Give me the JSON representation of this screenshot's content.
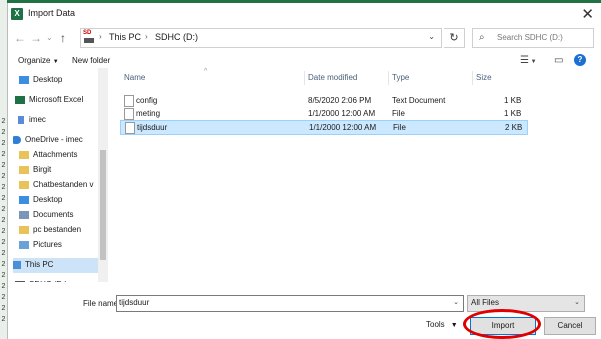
{
  "window": {
    "title": "Import Data",
    "close_glyph": "✕"
  },
  "excel_rows": [
    "2",
    "2",
    "2",
    "2",
    "2",
    "2",
    "2",
    "2",
    "2",
    "2",
    "2",
    "2",
    "2",
    "2",
    "2",
    "2",
    "2",
    "2",
    "2"
  ],
  "address": {
    "drive_badge": "SD",
    "crumbs": [
      "This PC",
      "SDHC (D:)"
    ],
    "separator": "›",
    "search_placeholder": "Search SDHC (D:)"
  },
  "toolbar": {
    "organize": "Organize",
    "new_folder": "New folder",
    "help": "?"
  },
  "sidebar": {
    "items": [
      {
        "label": "Desktop",
        "icon": "desktop-icon"
      },
      {
        "label": "Microsoft Excel",
        "icon": "excel-icon"
      },
      {
        "label": "imec",
        "icon": "person-icon"
      },
      {
        "label": "OneDrive - imec",
        "icon": "cloud-icon"
      },
      {
        "label": "Attachments",
        "icon": "folder-icon"
      },
      {
        "label": "Birgit",
        "icon": "folder-icon"
      },
      {
        "label": "Chatbestanden v",
        "icon": "folder-icon"
      },
      {
        "label": "Desktop",
        "icon": "desktop-icon"
      },
      {
        "label": "Documents",
        "icon": "documents-icon"
      },
      {
        "label": "pc bestanden",
        "icon": "folder-icon"
      },
      {
        "label": "Pictures",
        "icon": "pictures-icon"
      },
      {
        "label": "This PC",
        "icon": "pc-icon",
        "selected": true
      },
      {
        "label": "SDHC (D:)",
        "icon": "sd-card-icon"
      }
    ]
  },
  "columns": {
    "name": "Name",
    "date": "Date modified",
    "type": "Type",
    "size": "Size"
  },
  "files": [
    {
      "name": "config",
      "date": "8/5/2020 2:06 PM",
      "type": "Text Document",
      "size": "1 KB"
    },
    {
      "name": "meting",
      "date": "1/1/2000 12:00 AM",
      "type": "File",
      "size": "1 KB"
    },
    {
      "name": "tijdsduur",
      "date": "1/1/2000 12:00 AM",
      "type": "File",
      "size": "2 KB",
      "selected": true
    }
  ],
  "bottom": {
    "file_name_label": "File name:",
    "file_name_value": "tijdsduur",
    "file_type_value": "All Files",
    "tools": "Tools",
    "import": "Import",
    "cancel": "Cancel"
  },
  "colors": {
    "selection": "#cce8ff",
    "nav_selection": "#cde3f7",
    "highlight_ring": "#e00000",
    "excel_green": "#1e7145"
  }
}
